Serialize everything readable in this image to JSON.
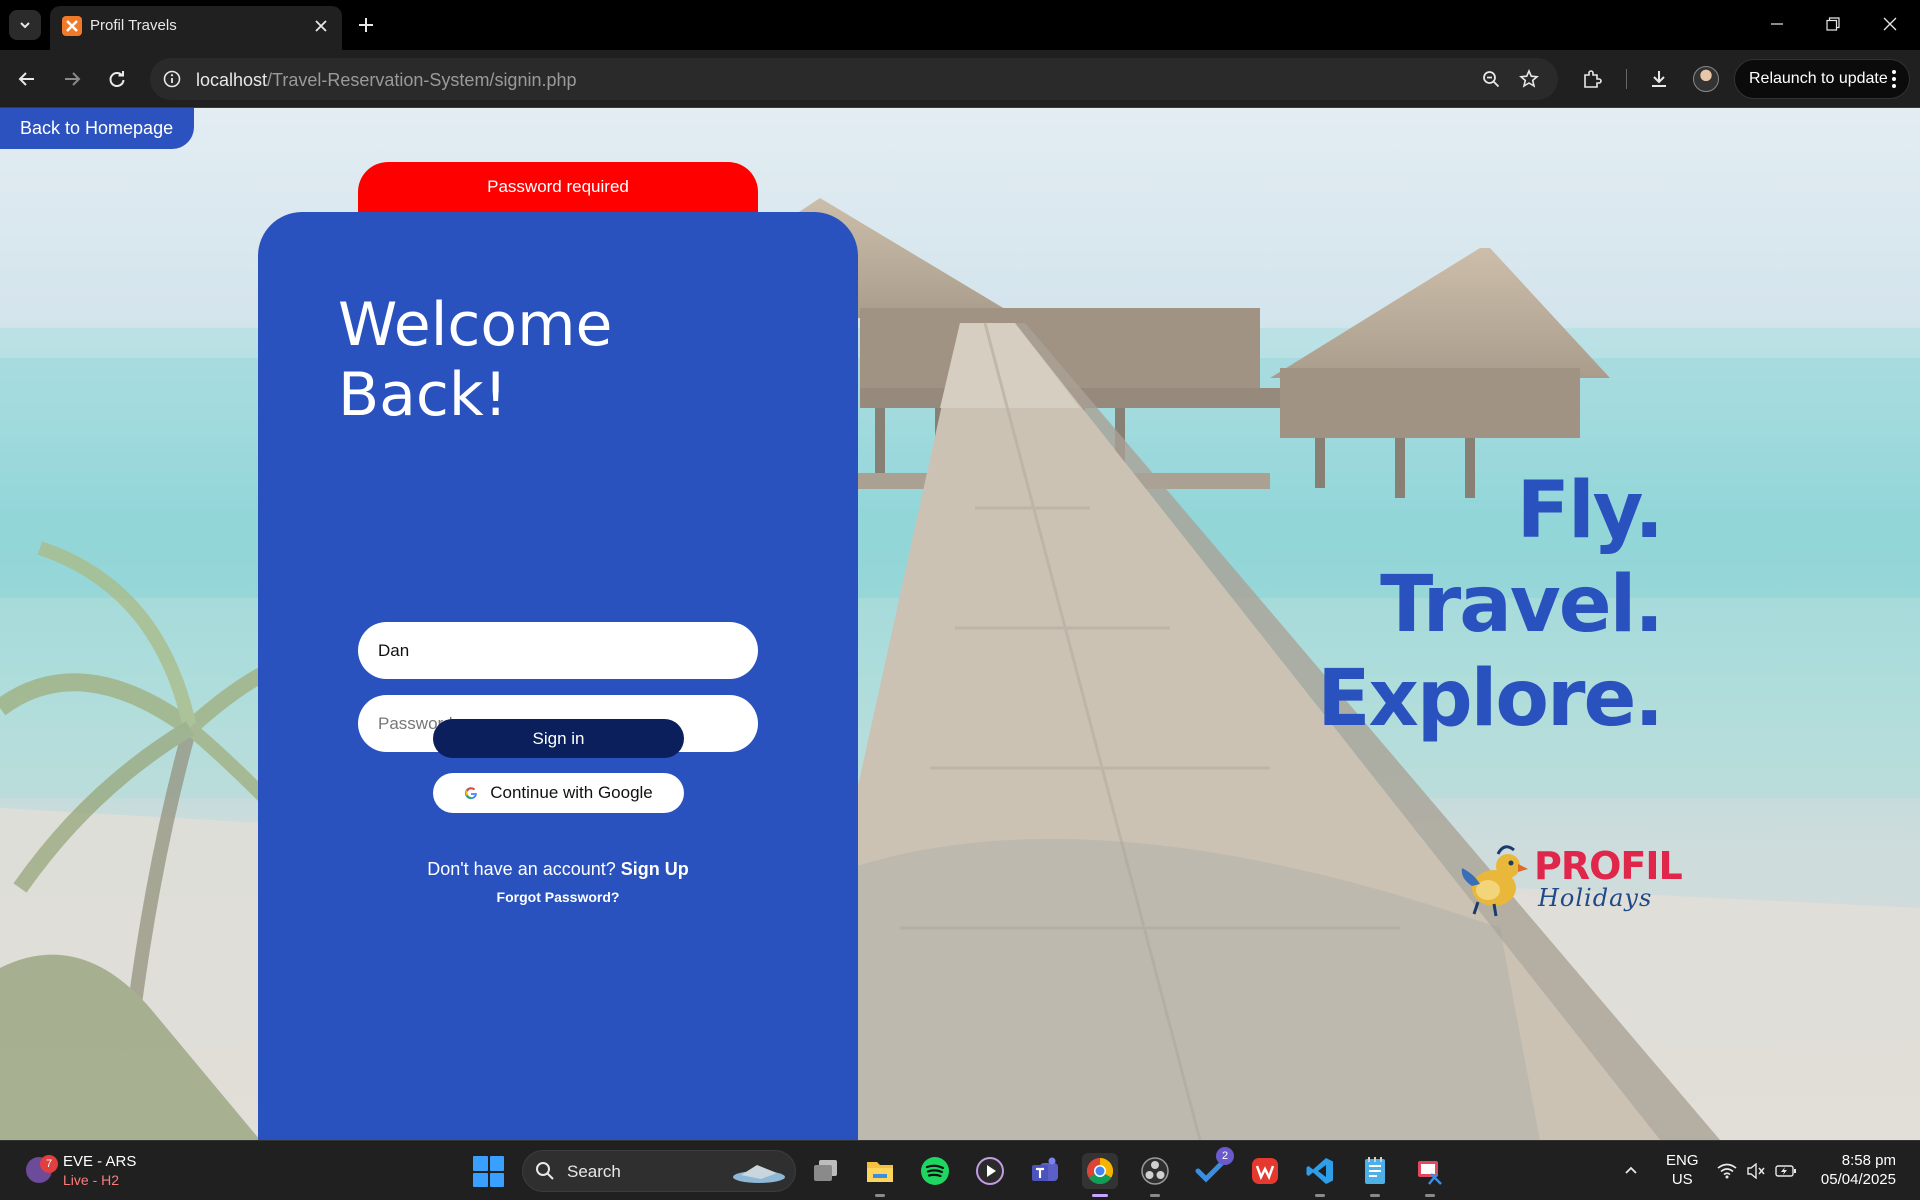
{
  "browser": {
    "tab_title": "Profil Travels",
    "url_host": "localhost",
    "url_path": "/Travel-Reservation-System/signin.php",
    "relaunch_label": "Relaunch to update"
  },
  "page": {
    "back_home_label": "Back to Homepage",
    "error_message": "Password required",
    "welcome_line1": "Welcome",
    "welcome_line2": "Back!",
    "username_value": "Dan",
    "password_placeholder": "Password",
    "signin_label": "Sign in",
    "google_label": "Continue with Google",
    "no_account_text": "Don't have an account?",
    "signup_label": "Sign Up",
    "forgot_label": "Forgot Password?",
    "tagline": [
      "Fly.",
      "Travel.",
      "Explore."
    ],
    "logo_brand": "PROFIL",
    "logo_sub": "Holidays",
    "colors": {
      "card": "#2a52be",
      "error": "#ff0000",
      "signin_button": "#0a1f5c",
      "logo_red": "#e0264a"
    }
  },
  "taskbar": {
    "live_title": "EVE - ARS",
    "live_status": "Live - H2",
    "live_badge": "7",
    "search_label": "Search",
    "todo_badge": "2",
    "lang_line1": "ENG",
    "lang_line2": "US",
    "time": "8:58 pm",
    "date": "05/04/2025",
    "apps": [
      "task-view",
      "file-explorer",
      "spotify",
      "media-player",
      "teams",
      "chrome",
      "obs",
      "todo",
      "wps-office",
      "vscode",
      "notepad",
      "snipping-tool"
    ]
  }
}
